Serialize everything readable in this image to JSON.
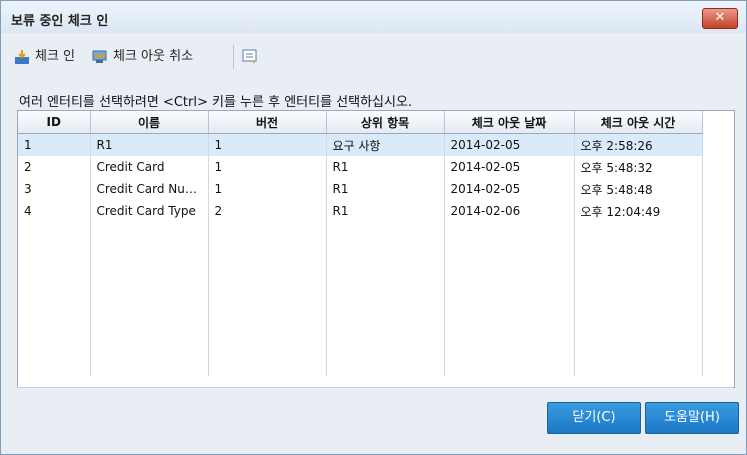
{
  "window": {
    "title": "보류 중인 체크 인",
    "close_label": "✕"
  },
  "toolbar": {
    "checkin_label": "체크 인",
    "undo_checkout_label": "체크 아웃 취소"
  },
  "instruction": "여러 엔터티를 선택하려면 <Ctrl> 키를 누른 후 엔터티를 선택하십시오.",
  "table": {
    "columns": [
      "ID",
      "이름",
      "버전",
      "상위 항목",
      "체크 아웃 날짜",
      "체크 아웃 시간"
    ],
    "rows": [
      [
        "1",
        "R1",
        "1",
        "요구 사항",
        "2014-02-05",
        "오후 2:58:26"
      ],
      [
        "2",
        "Credit Card",
        "1",
        "R1",
        "2014-02-05",
        "오후 5:48:32"
      ],
      [
        "3",
        "Credit Card Num...",
        "1",
        "R1",
        "2014-02-05",
        "오후 5:48:48"
      ],
      [
        "4",
        "Credit Card Type",
        "2",
        "R1",
        "2014-02-06",
        "오후 12:04:49"
      ]
    ],
    "selected_row": 0
  },
  "buttons": {
    "close_label": "닫기(C)",
    "help_label": "도움말(H)"
  }
}
